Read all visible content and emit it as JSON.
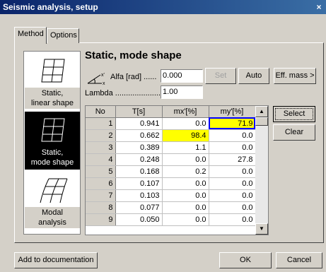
{
  "window": {
    "title": "Seismic analysis, setup",
    "close_glyph": "×"
  },
  "tabs": [
    {
      "label": "Method"
    },
    {
      "label": "Options"
    }
  ],
  "analysis_types": [
    {
      "label_line1": "Static,",
      "label_line2": "linear shape",
      "icon": "static-linear-frame-icon"
    },
    {
      "label_line1": "Static,",
      "label_line2": "mode shape",
      "icon": "static-mode-frame-icon"
    },
    {
      "label_line1": "Modal",
      "label_line2": "analysis",
      "icon": "modal-frame-icon"
    }
  ],
  "heading": "Static, mode shape",
  "alfa": {
    "label": "Alfa [rad] ......",
    "value": "0.000"
  },
  "lambda": {
    "label": "Lambda ......................",
    "value": "1.00"
  },
  "buttons": {
    "set": "Set",
    "auto": "Auto",
    "eff_mass": "Eff. mass >",
    "select": "Select",
    "clear": "Clear",
    "add_doc": "Add to documentation",
    "ok": "OK",
    "cancel": "Cancel"
  },
  "table": {
    "headers": [
      "No",
      "T[s]",
      "mx'[%]",
      "my'[%]"
    ],
    "rows": [
      [
        "1",
        "0.941",
        "0.0",
        "71.9"
      ],
      [
        "2",
        "0.662",
        "98.4",
        "0.0"
      ],
      [
        "3",
        "0.389",
        "1.1",
        "0.0"
      ],
      [
        "4",
        "0.248",
        "0.0",
        "27.8"
      ],
      [
        "5",
        "0.168",
        "0.2",
        "0.0"
      ],
      [
        "6",
        "0.107",
        "0.0",
        "0.0"
      ],
      [
        "7",
        "0.103",
        "0.0",
        "0.0"
      ],
      [
        "8",
        "0.077",
        "0.0",
        "0.0"
      ],
      [
        "9",
        "0.050",
        "0.0",
        "0.0"
      ]
    ]
  },
  "colors": {
    "highlight": "#ffff00",
    "selection_border": "#0000ff",
    "title_bar": "#0a246a"
  }
}
